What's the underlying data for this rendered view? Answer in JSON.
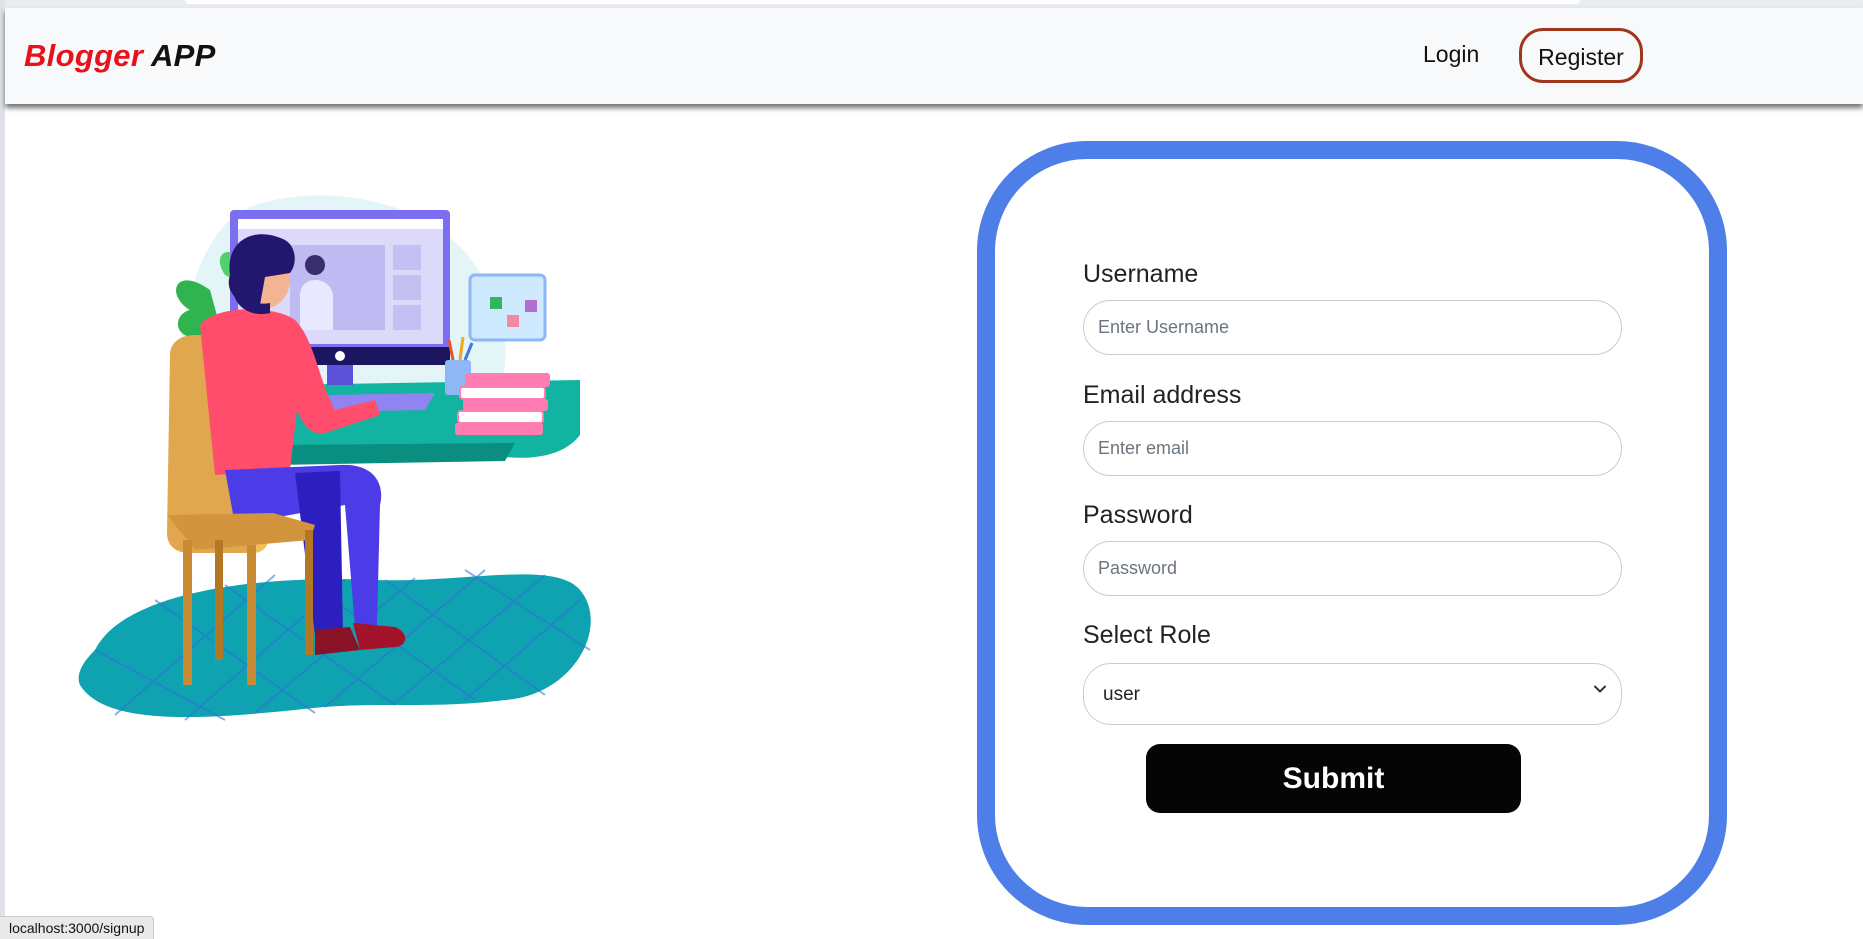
{
  "navbar": {
    "brand_part1": "Blogger",
    "brand_part2": "APP",
    "login_label": "Login",
    "register_label": "Register",
    "brand_accent_color": "#e8121b",
    "register_border_color": "#a0361c"
  },
  "form": {
    "card_border_color": "#4e7fe8",
    "username": {
      "label": "Username",
      "placeholder": "Enter Username",
      "value": ""
    },
    "email": {
      "label": "Email address",
      "placeholder": "Enter email",
      "value": ""
    },
    "password": {
      "label": "Password",
      "placeholder": "Password",
      "value": ""
    },
    "role": {
      "label": "Select Role",
      "selected": "user",
      "icon": "chevron-down-icon"
    },
    "submit_label": "Submit"
  },
  "illustration": {
    "icon": "person-at-computer-illustration"
  },
  "status_bar": {
    "url": "localhost:3000/signup"
  }
}
